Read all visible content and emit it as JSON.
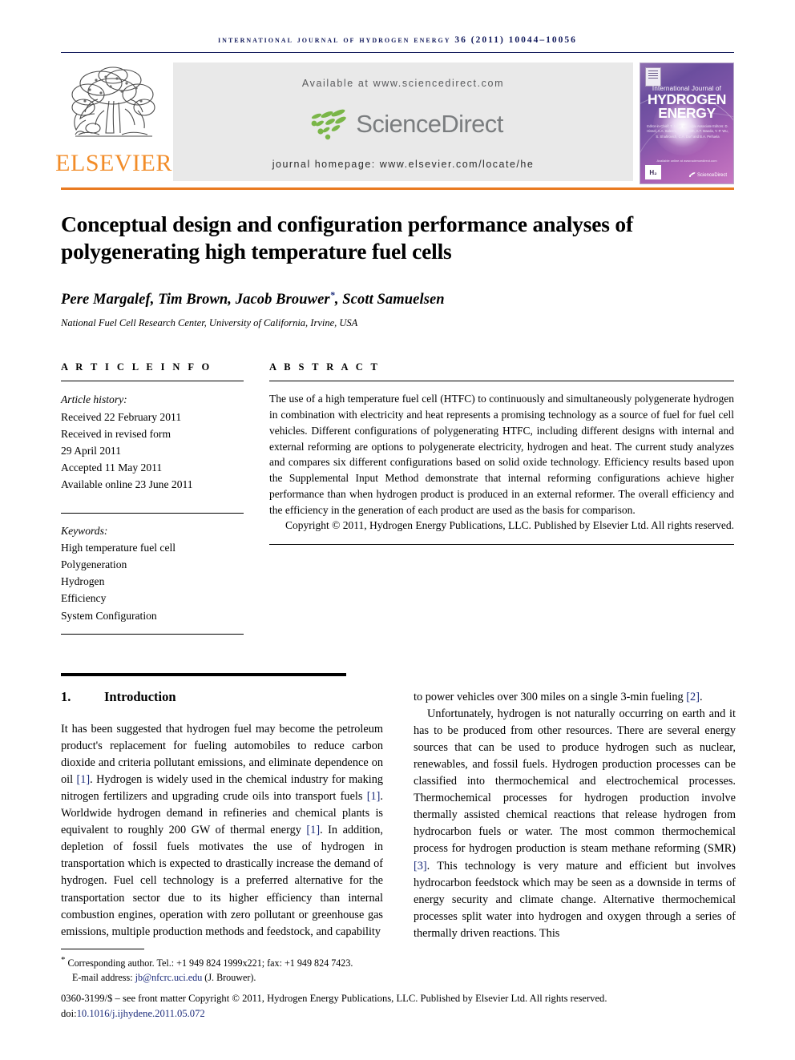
{
  "running_head": "international journal of hydrogen energy 36 (2011) 10044–10056",
  "publisher": {
    "name": "ELSEVIER",
    "logo_icon": "elsevier-tree-icon"
  },
  "sciencedirect_banner": {
    "available_at": "Available at www.sciencedirect.com",
    "wordmark": "ScienceDirect",
    "logo_icon": "sciencedirect-leaves-icon",
    "journal_homepage": "journal homepage: www.elsevier.com/locate/he"
  },
  "journal_cover": {
    "title_small": "International Journal of",
    "title_line1": "HYDROGEN",
    "title_line2": "ENERGY",
    "editors": "Editor-in-Chief:  T. Nejat Veziroğlu\nAssociate Editors: D. Hissel, A.A. Saleem, R.D. Smith, A.T. Maeda, Y.-P. Wu, S. Shafirovich, C.A. Dorf and B.A. Peñuela",
    "footer_mark": "H₂",
    "availability": "Available online at www.sciencedirect.com",
    "sciencedirect": "ScienceDirect"
  },
  "article": {
    "title": "Conceptual design and configuration performance analyses of polygenerating high temperature fuel cells",
    "authors": "Pere Margalef, Tim Brown, Jacob Brouwer",
    "corresponding_marker": "*",
    "authors_tail": ", Scott Samuelsen",
    "affiliation": "National Fuel Cell Research Center, University of California, Irvine, USA"
  },
  "article_info": {
    "label": "A R T I C L E   I N F O",
    "history_label": "Article history:",
    "history": [
      "Received 22 February 2011",
      "Received in revised form",
      "29 April 2011",
      "Accepted 11 May 2011",
      "Available online 23 June 2011"
    ],
    "keywords_label": "Keywords:",
    "keywords": [
      "High temperature fuel cell",
      "Polygeneration",
      "Hydrogen",
      "Efficiency",
      "System Configuration"
    ]
  },
  "abstract": {
    "label": "A B S T R A C T",
    "text": "The use of a high temperature fuel cell (HTFC) to continuously and simultaneously polygenerate hydrogen in combination with electricity and heat represents a promising technology as a source of fuel for fuel cell vehicles. Different configurations of polygenerating HTFC, including different designs with internal and external reforming are options to polygenerate electricity, hydrogen and heat. The current study analyzes and compares six different configurations based on solid oxide technology. Efficiency results based upon the Supplemental Input Method demonstrate that internal reforming configurations achieve higher performance than when hydrogen product is produced in an external reformer. The overall efficiency and the efficiency in the generation of each product are used as the basis for comparison.",
    "copyright": "Copyright © 2011, Hydrogen Energy Publications, LLC. Published by Elsevier Ltd. All rights reserved."
  },
  "body": {
    "section_number": "1.",
    "section_title": "Introduction",
    "left_paragraph_1_a": "It has been suggested that hydrogen fuel may become the petroleum product's replacement for fueling automobiles to reduce carbon dioxide and criteria pollutant emissions, and eliminate dependence on oil ",
    "cite_1": "[1]",
    "left_paragraph_1_b": ". Hydrogen is widely used in the chemical industry for making nitrogen fertilizers and upgrading crude oils into transport fuels ",
    "left_paragraph_1_c": ". Worldwide hydrogen demand in refineries and chemical plants is equivalent to roughly 200 GW of thermal energy ",
    "left_paragraph_1_d": ". In addition, depletion of fossil fuels motivates the use of hydrogen in transportation which is expected to drastically increase the demand of hydrogen. Fuel cell technology is a preferred alternative for the transportation sector due to its higher efficiency than internal combustion engines, operation with zero pollutant or greenhouse gas emissions, multiple production methods and feedstock, and capability",
    "right_paragraph_1_a": "to power vehicles over 300 miles on a single 3-min fueling ",
    "cite_2": "[2]",
    "right_paragraph_1_b": ".",
    "right_paragraph_2_a": "Unfortunately, hydrogen is not naturally occurring on earth and it has to be produced from other resources. There are several energy sources that can be used to produce hydrogen such as nuclear, renewables, and fossil fuels. Hydrogen production processes can be classified into thermochemical and electrochemical processes. Thermochemical processes for hydrogen production involve thermally assisted chemical reactions that release hydrogen from hydrocarbon fuels or water. The most common thermochemical process for hydrogen production is steam methane reforming (SMR) ",
    "cite_3": "[3]",
    "right_paragraph_2_b": ". This technology is very mature and efficient but involves hydrocarbon feedstock which may be seen as a downside in terms of energy security and climate change. Alternative thermochemical processes split water into hydrogen and oxygen through a series of thermally driven reactions. This"
  },
  "footnotes": {
    "corresponding_marker": "*",
    "corresponding": "Corresponding author. Tel.: +1 949 824 1999x221; fax: +1 949 824 7423.",
    "email_label": "E-mail address: ",
    "email": "jb@nfcrc.uci.edu",
    "email_suffix": " (J. Brouwer).",
    "front_matter": "0360-3199/$ – see front matter Copyright © 2011, Hydrogen Energy Publications, LLC. Published by Elsevier Ltd. All rights reserved.",
    "doi_prefix": "doi:",
    "doi": "10.1016/j.ijhydene.2011.05.072"
  },
  "colors": {
    "running_head": "#121a5c",
    "elsevier_orange": "#f28c28",
    "title_rule_orange": "#e97a20",
    "sciencedirect_green": "#7ab648",
    "sciencedirect_gray": "#7a7d7f",
    "link_blue": "#1a2a7a",
    "banner_bg": "#e9e9e9"
  }
}
